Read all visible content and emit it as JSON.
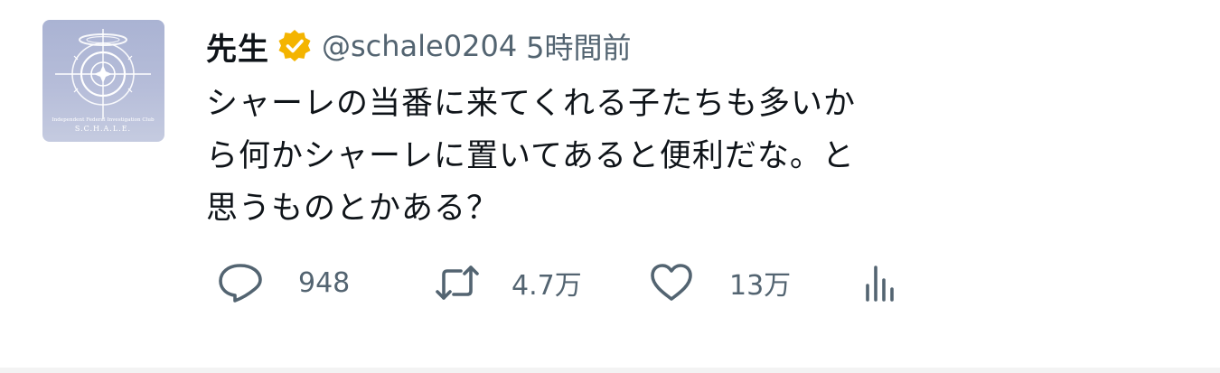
{
  "tweet": {
    "author": {
      "display_name": "先生",
      "handle": "@schale0204",
      "verified": true,
      "avatar_caption_line1": "Independent Federal Investigation Club",
      "avatar_caption_line2": "S.C.H.A.L.E."
    },
    "timestamp": "5時間前",
    "text_lines": [
      "シャーレの当番に来てくれる子たちも多いか",
      "ら何かシャーレに置いてあると便利だな。と",
      "思うものとかある？"
    ],
    "metrics": {
      "replies": "948",
      "retweets": "4.7万",
      "likes": "13万"
    }
  },
  "icons": {
    "reply": "speech-bubble-icon",
    "retweet": "retweet-arrows-icon",
    "like": "heart-icon",
    "views": "bar-chart-icon",
    "verified": "verified-badge-icon"
  },
  "colors": {
    "verified_badge": "#f4b400",
    "secondary_text": "#536471",
    "primary_text": "#0f1419",
    "avatar_bg": "#b3bad6"
  }
}
